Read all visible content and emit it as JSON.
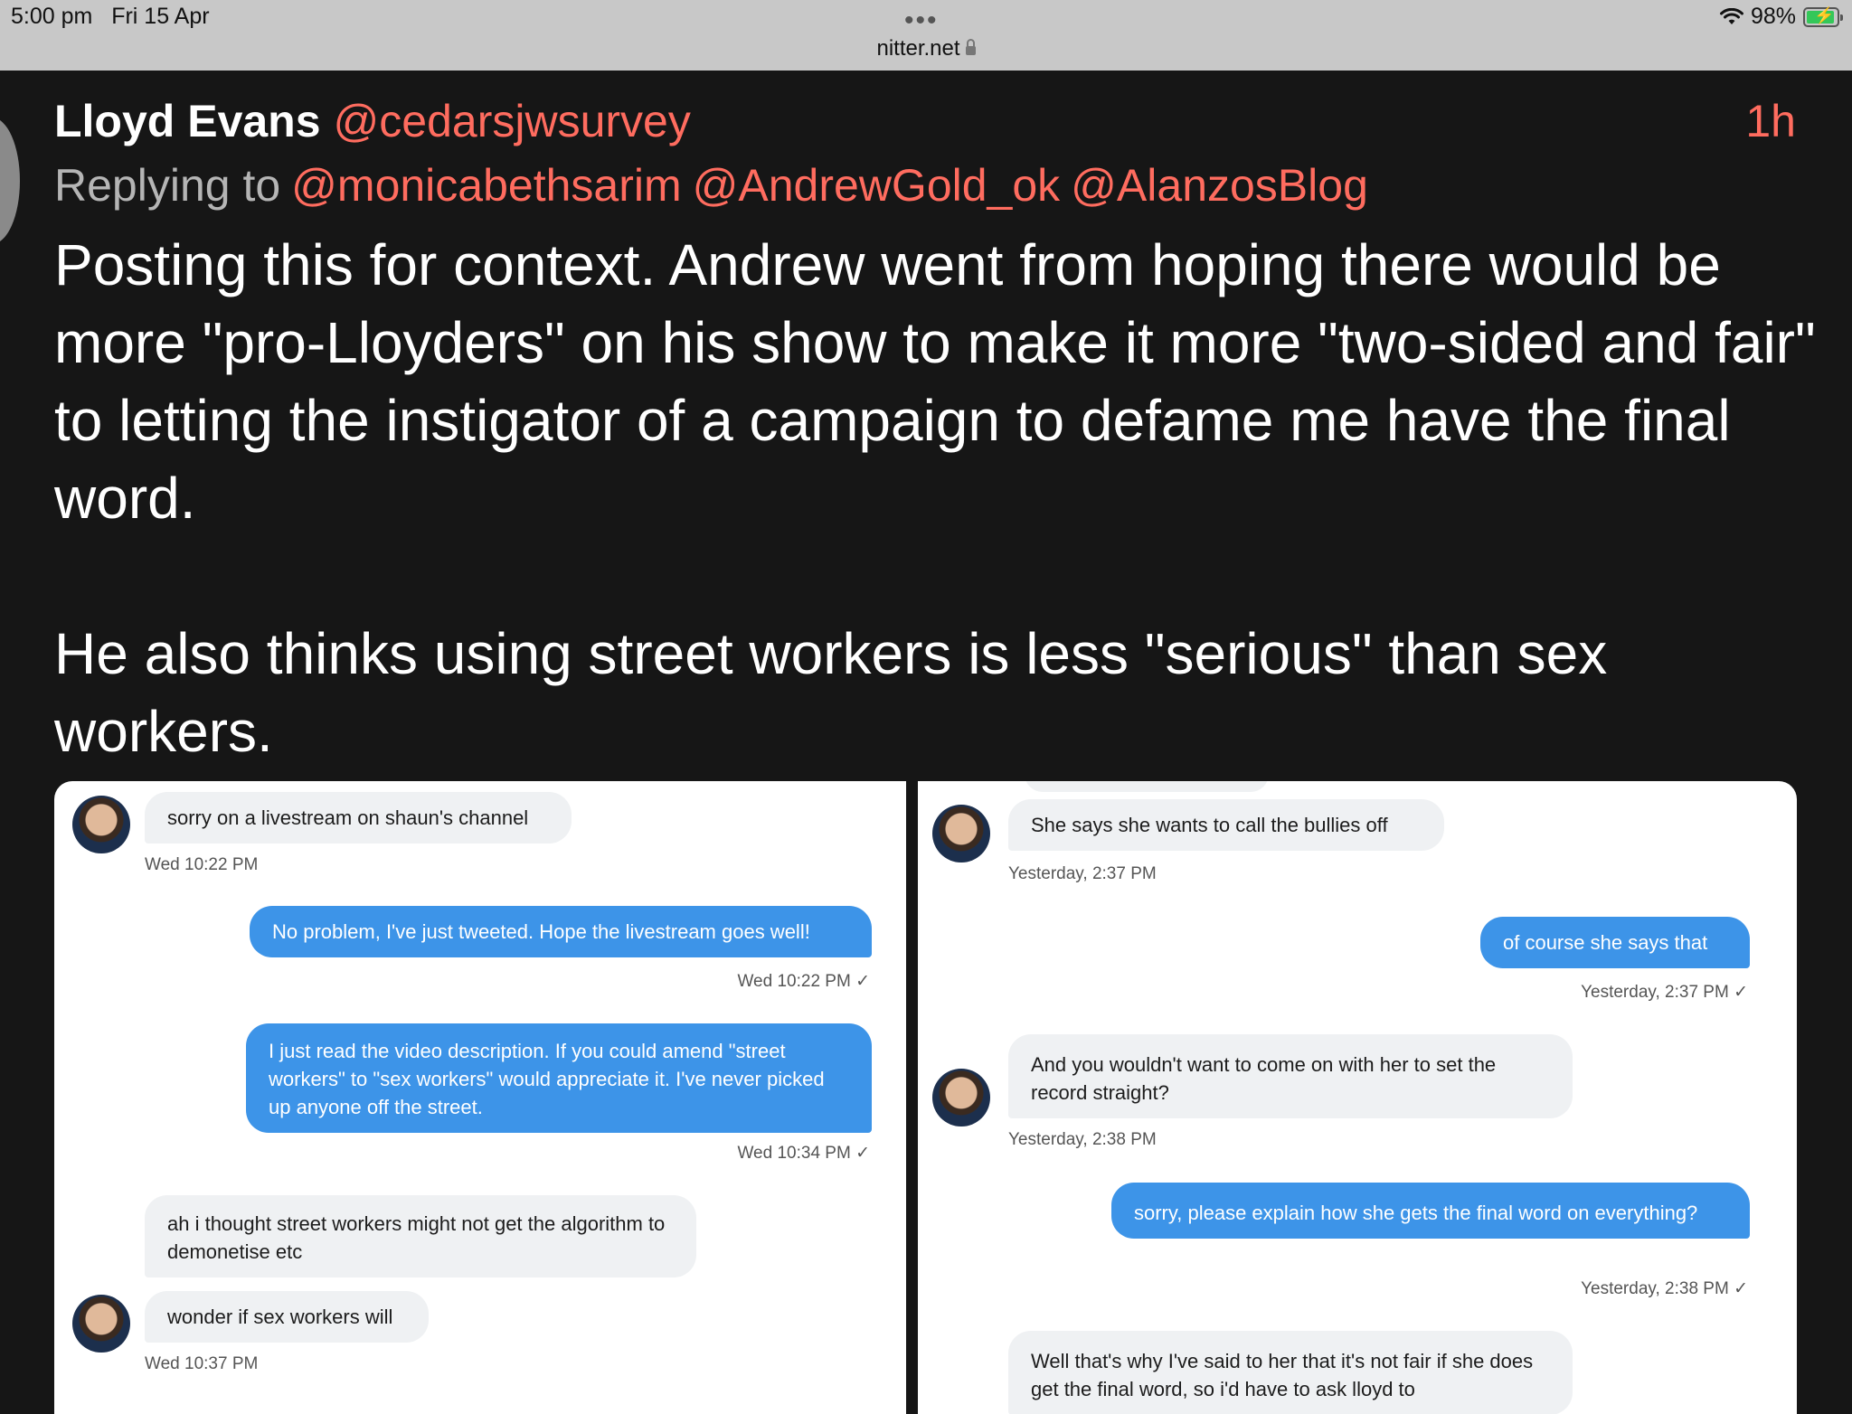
{
  "status_bar": {
    "time": "5:00 pm",
    "date": "Fri 15 Apr",
    "url": "nitter.net",
    "battery": "98%",
    "more_dots": "•••"
  },
  "tweet": {
    "author_name": "Lloyd Evans",
    "author_handle": "@cedarsjwsurvey",
    "time": "1h",
    "replying_prefix": "Replying to",
    "mentions": [
      "@monicabethsarim",
      "@AndrewGold_ok",
      "@AlanzosBlog"
    ],
    "paragraphs": [
      "Posting this for context. Andrew went from hoping there would be more \"pro-Lloyders\" on his show to make it more \"two-sided and fair\" to letting the instigator of a campaign to defame me have the final word.",
      "He also thinks using street workers is less \"serious\" than sex workers."
    ]
  },
  "left_image": {
    "messages": [
      {
        "dir": "in",
        "text": "sorry on a livestream on shaun's channel",
        "stamp": "Wed 10:22 PM"
      },
      {
        "dir": "out",
        "text": "No problem, I've just tweeted. Hope the livestream goes well!",
        "stamp": "Wed 10:22 PM ✓"
      },
      {
        "dir": "out",
        "text": "I just read the video description. If you could amend \"street workers\" to \"sex workers\" would appreciate it. I've never picked up anyone off the street.",
        "stamp": "Wed 10:34 PM ✓"
      },
      {
        "dir": "in",
        "text": "ah i thought street workers might not get the algorithm to demonetise etc",
        "stamp": ""
      },
      {
        "dir": "in",
        "text": "wonder if sex workers will",
        "stamp": "Wed 10:37 PM"
      }
    ]
  },
  "right_image": {
    "messages": [
      {
        "dir": "in",
        "text": "She says she wants to call the bullies off",
        "stamp": "Yesterday, 2:37 PM"
      },
      {
        "dir": "out",
        "text": "of course she says that",
        "stamp": "Yesterday, 2:37 PM ✓"
      },
      {
        "dir": "in",
        "text": "And you wouldn't want to come on with her to set the record straight?",
        "stamp": "Yesterday, 2:38 PM"
      },
      {
        "dir": "out",
        "text": "sorry, please explain how she gets the final word on everything?",
        "stamp": "Yesterday, 2:38 PM ✓"
      },
      {
        "dir": "in",
        "text": "Well that's why I've said to her that it's not fair if she does get the final word, so i'd have to ask lloyd to",
        "stamp": ""
      }
    ]
  }
}
